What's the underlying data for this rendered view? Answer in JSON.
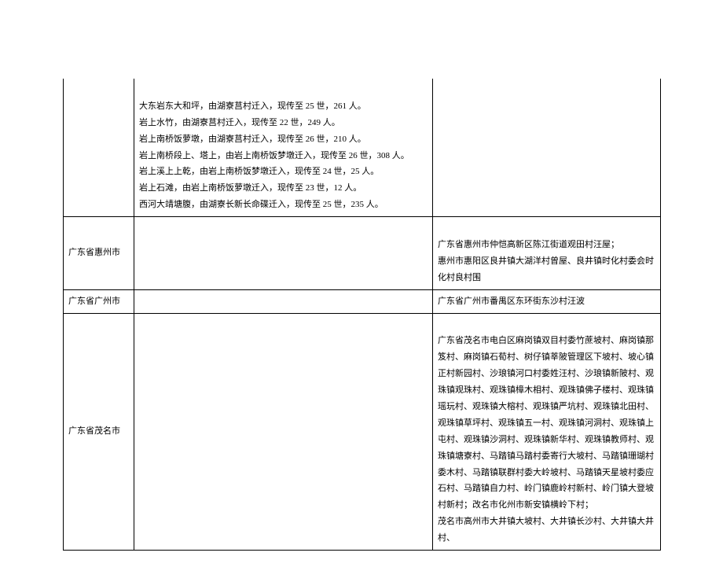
{
  "rows": [
    {
      "region": "",
      "detail_left": "大东岩东大和坪，由湖寮莒村迁入，现传至 25 世，261 人。\n岩上水竹，由湖寮莒村迁入，现传至 22 世，249 人。\n岩上南桥饭萝墩，由湖寮莒村迁入，现传至 26 世，210 人。\n岩上南桥段上、塔上，由岩上南桥饭梦墩迁入，现传至 26 世，308 人。\n岩上溪上上乾，由岩上南桥饭梦墩迁入，现传至 24 世，25 人。\n岩上石滩，由岩上南桥饭萝墩迁入，现传至 23 世，12 人。\n西河大靖塘腹，由湖寮长新长命碟迁入，现传至 25 世，235 人。",
      "detail_right": ""
    },
    {
      "region": "广东省惠州市",
      "detail_left": "",
      "detail_right": "广东省惠州市仲恺高新区陈江街道观田村汪屋；\n惠州市惠阳区良井镇大湖洋村曾屋、良井镇时化村委会时化村良村围"
    },
    {
      "region": "广东省广州市",
      "detail_left": "",
      "detail_right": "广东省广州市番禺区东环街东沙村汪波"
    },
    {
      "region": "广东省茂名市",
      "detail_left": "",
      "detail_right": "广东省茂名市电白区麻岗镇双目村委竹蔗坡村、麻岗镇那笈村、麻岗镇石荀村、树仔镇莘陂管理区下坡村、坡心镇正村新园村、沙琅镇河口村委姓汪村、沙琅镇新陂村、观珠镇观珠村、观珠镇樟木相村、观珠镇佛子楼村、观珠镇瑶玩村、观珠镇大榕村、观珠镇严坑村、观珠镇北田村、观珠镇草坪村、观珠镇五一村、观珠镇河洞村、观珠镇上屯村、观珠镇沙洞村、观珠镇新华村、观珠镇教师村、观珠镇塘寮村、马踏镇马踏村委寄行大坡村、马踏镇珊瑚村委木村、马踏镇联群村委大岭坡村、马踏镇天星坡村委应石村、马踏镇自力村、岭门镇鹿岭村新村、岭门镇大登坡村新村；改名市化州市新安镇横岭下村；\n茂名市高州市大井镇大坡村、大井镇长沙村、大井镇大井村、"
    }
  ]
}
